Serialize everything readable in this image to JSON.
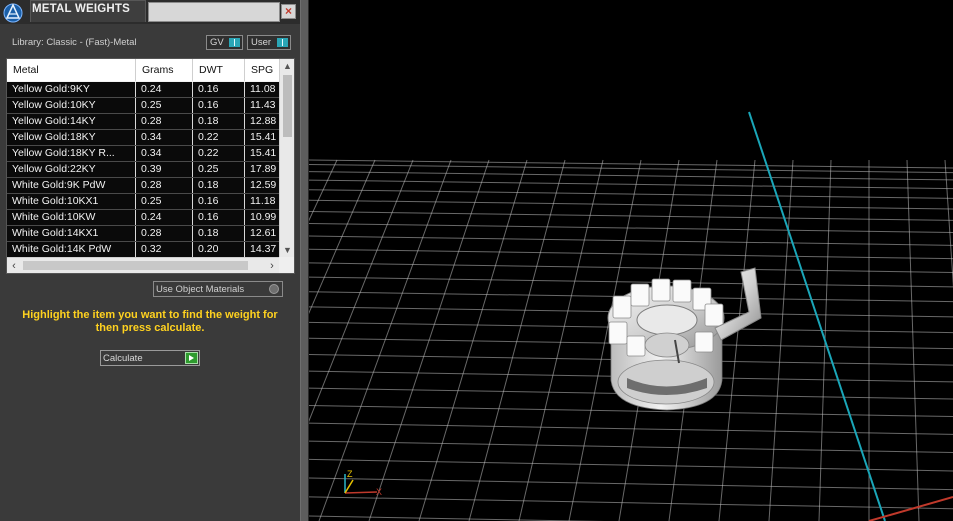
{
  "panel": {
    "title": "METAL WEIGHTS",
    "close_glyph": "×",
    "library_label": "Library: Classic - (Fast)-Metal",
    "toggles": [
      {
        "label": "GV",
        "state": "on"
      },
      {
        "label": "User",
        "state": "on"
      }
    ],
    "table": {
      "headers": [
        "Metal",
        "Grams",
        "DWT",
        "SPG"
      ],
      "rows": [
        [
          "Yellow Gold:9KY",
          "0.24",
          "0.16",
          "11.08"
        ],
        [
          "Yellow Gold:10KY",
          "0.25",
          "0.16",
          "11.43"
        ],
        [
          "Yellow Gold:14KY",
          "0.28",
          "0.18",
          "12.88"
        ],
        [
          "Yellow Gold:18KY",
          "0.34",
          "0.22",
          "15.41"
        ],
        [
          "Yellow Gold:18KY R...",
          "0.34",
          "0.22",
          "15.41"
        ],
        [
          "Yellow Gold:22KY",
          "0.39",
          "0.25",
          "17.89"
        ],
        [
          "White Gold:9K PdW",
          "0.28",
          "0.18",
          "12.59"
        ],
        [
          "White Gold:10KX1",
          "0.25",
          "0.16",
          "11.18"
        ],
        [
          "White Gold:10KW",
          "0.24",
          "0.16",
          "10.99"
        ],
        [
          "White Gold:14KX1",
          "0.28",
          "0.18",
          "12.61"
        ],
        [
          "White Gold:14K PdW",
          "0.32",
          "0.20",
          "14.37"
        ]
      ],
      "scroll_up_icon": "chevron-up-icon",
      "scroll_down_icon": "chevron-down-icon"
    },
    "use_object_materials_label": "Use Object Materials",
    "hint_text": "Highlight the item you want to find the weight for then press calculate.",
    "calculate_label": "Calculate"
  },
  "viewport": {
    "background": "#000000",
    "grid_color": "#bdbdbd",
    "axis_y_color": "#1aa6b8",
    "axis_x_color": "#c0392b",
    "gizmo_labels": {
      "z": "Z",
      "x": "X"
    }
  },
  "colors": {
    "accent_teal": "#2aa6b6",
    "hint_yellow": "#ffd21f",
    "go_green": "#2e9b2e"
  }
}
